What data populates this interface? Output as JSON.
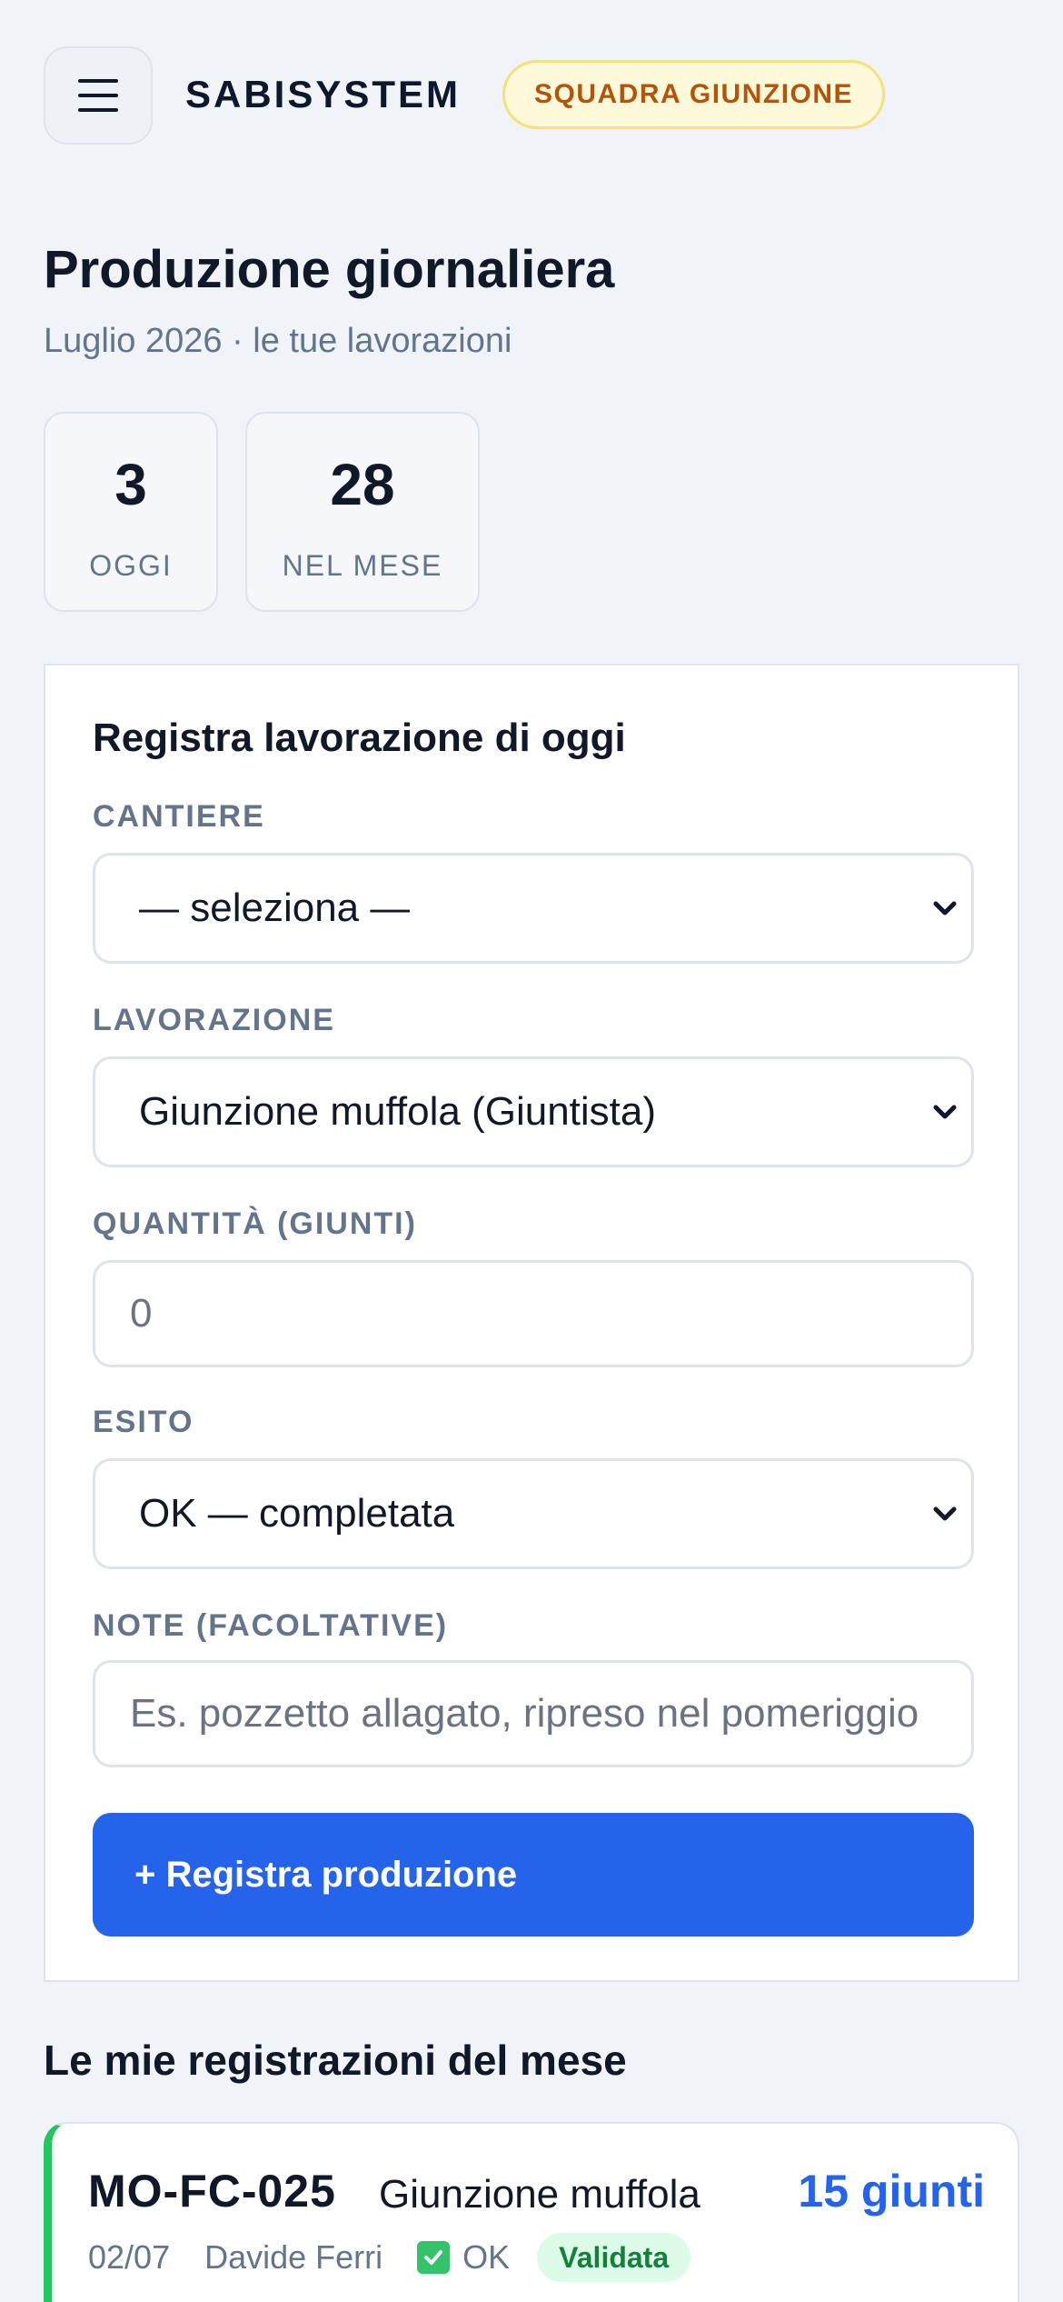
{
  "header": {
    "brand": "SABISYSTEM",
    "team_badge": "SQUADRA GIUNZIONE"
  },
  "page": {
    "title": "Produzione giornaliera",
    "subtitle": "Luglio 2026 · le tue lavorazioni"
  },
  "stats": {
    "today": {
      "value": "3",
      "label": "OGGI"
    },
    "month": {
      "value": "28",
      "label": "NEL MESE"
    }
  },
  "form": {
    "title": "Registra lavorazione di oggi",
    "cantiere": {
      "label": "CANTIERE",
      "value": "— seleziona —"
    },
    "lavorazione": {
      "label": "LAVORAZIONE",
      "value": "Giunzione muffola (Giuntista)"
    },
    "quantita": {
      "label": "QUANTITÀ (GIUNTI)",
      "placeholder": "0"
    },
    "esito": {
      "label": "ESITO",
      "value": "OK — completata"
    },
    "note": {
      "label": "NOTE (FACOLTATIVE)",
      "placeholder": "Es. pozzetto allagato, ripreso nel pomeriggio"
    },
    "submit_label": "+ Registra produzione"
  },
  "records": {
    "title": "Le mie registrazioni del mese",
    "items": [
      {
        "code": "MO-FC-025",
        "type": "Giunzione muffola",
        "quantity": "15 giunti",
        "date": "02/07",
        "operator": "Davide Ferri",
        "outcome": "OK",
        "status": "Validata"
      }
    ]
  },
  "colors": {
    "accent": "#2563eb",
    "badge_text": "#b45309",
    "badge_bg": "#fef9d9",
    "success": "#22c55e",
    "status_validated_bg": "#dcfce7",
    "status_validated_text": "#15803d"
  },
  "icons": {
    "menu": "hamburger-menu-icon",
    "select": "chevron-down-icon",
    "outcome_ok": "check-box-icon"
  }
}
